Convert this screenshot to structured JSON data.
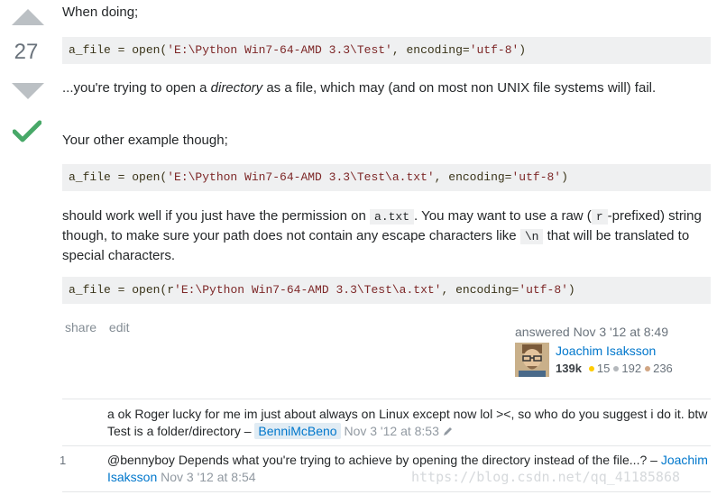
{
  "vote": {
    "count": "27"
  },
  "body": {
    "p1": "When doing;",
    "code1": {
      "pre": "a_file = open(",
      "str1": "'E:\\Python Win7-64-AMD 3.3\\Test'",
      "mid": ", encoding=",
      "str2": "'utf-8'",
      "post": ")"
    },
    "p2_pre": "...you're trying to open a ",
    "p2_em": "directory",
    "p2_post": " as a file, which may (and on most non UNIX file systems will) fail.",
    "p3": "Your other example though;",
    "code2": {
      "pre": "a_file = open(",
      "str1": "'E:\\Python Win7-64-AMD 3.3\\Test\\a.txt'",
      "mid": ", encoding=",
      "str2": "'utf-8'",
      "post": ")"
    },
    "p4_a": "should work well if you just have the permission on ",
    "p4_code1": "a.txt",
    "p4_b": ". You may want to use a raw (",
    "p4_code2": "r",
    "p4_c": "-prefixed) string though, to make sure your path does not contain any escape characters like ",
    "p4_code3": "\\n",
    "p4_d": " that will be translated to special characters.",
    "code3": {
      "pre": "a_file = open(r",
      "str1": "'E:\\Python Win7-64-AMD 3.3\\Test\\a.txt'",
      "mid": ", encoding=",
      "str2": "'utf-8'",
      "post": ")"
    }
  },
  "post_menu": {
    "share": "share",
    "edit": "edit"
  },
  "signature": {
    "answered": "answered Nov 3 '12 at 8:49",
    "user": "Joachim Isaksson",
    "rep": "139k",
    "gold": "15",
    "silver": "192",
    "bronze": "236",
    "colors": {
      "gold": "#ffcc01",
      "silver": "#b4b8bc",
      "bronze": "#d1a684"
    }
  },
  "comments": [
    {
      "score": "",
      "text": "a ok Roger lucky for me im just about always on Linux except now lol ><, so who do you suggest i do it. btw Test is a folder/directory – ",
      "user": "BenniMcBeno",
      "date": "Nov 3 '12 at 8:53",
      "icon": "pencil-icon"
    },
    {
      "score": "1",
      "text": "@bennyboy Depends what you're trying to achieve by opening the directory instead of the file...? – ",
      "user": "Joachim Isaksson",
      "date": "Nov 3 '12 at 8:54"
    }
  ],
  "watermark": "https://blog.csdn.net/qq_41185868"
}
